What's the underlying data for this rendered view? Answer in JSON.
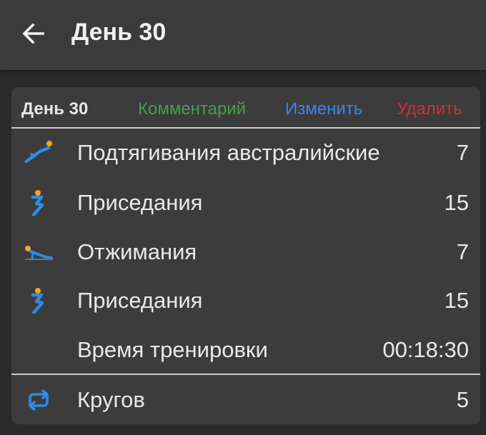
{
  "appbar": {
    "title": "День 30"
  },
  "card": {
    "title": "День 30",
    "comment_label": "Комментарий",
    "edit_label": "Изменить",
    "delete_label": "Удалить",
    "exercises": [
      {
        "icon": "australian-pullup-icon",
        "name": "Подтягивания австралийские",
        "count": "7"
      },
      {
        "icon": "squat-icon",
        "name": "Приседания",
        "count": "15"
      },
      {
        "icon": "pushup-icon",
        "name": "Отжимания",
        "count": "7"
      },
      {
        "icon": "squat-icon",
        "name": "Приседания",
        "count": "15"
      }
    ],
    "workout_time_label": "Время тренировки",
    "workout_time_value": "00:18:30",
    "rounds_label": "Кругов",
    "rounds_value": "5"
  },
  "colors": {
    "comment": "#43a047",
    "edit": "#3b82f6",
    "delete": "#d32f2f",
    "icon_body": "#2f8be6",
    "icon_head": "#f5a623"
  }
}
